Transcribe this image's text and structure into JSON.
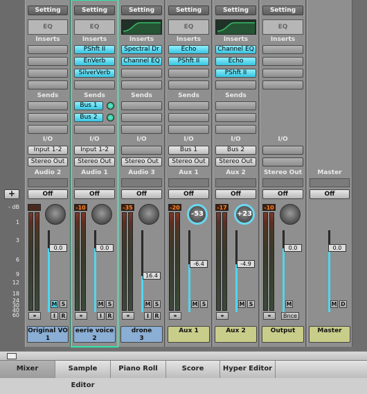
{
  "strips": [
    {
      "id": "audio2",
      "setting": "Setting",
      "eq_label": "EQ",
      "eq_curve": false,
      "inserts_label": "Inserts",
      "inserts": [
        "",
        "",
        "",
        ""
      ],
      "sends_label": "Sends",
      "sends": [
        "",
        "",
        ""
      ],
      "io_label": "I/O",
      "input": "Input 1-2",
      "output": "Stereo Out",
      "strip_label": "Audio 2",
      "auto": "Off",
      "peak": "",
      "knob_value": "",
      "fader_value": "0.0",
      "m": "M",
      "s": "S",
      "i": "I",
      "r": "R",
      "ms_on": true,
      "name": "Original VO\n1",
      "name_color": "blue",
      "selected": false
    },
    {
      "id": "audio1",
      "setting": "Setting",
      "eq_label": "EQ",
      "eq_curve": false,
      "inserts_label": "Inserts",
      "inserts": [
        "PShft II",
        "EnVerb",
        "SilverVerb",
        ""
      ],
      "sends_label": "Sends",
      "sends": [
        "Bus 1",
        "Bus 2",
        ""
      ],
      "io_label": "I/O",
      "input": "Input 1-2",
      "output": "Stereo Out",
      "strip_label": "Audio 1",
      "auto": "Off",
      "peak": "-10",
      "knob_value": "",
      "fader_value": "0.0",
      "m": "M",
      "s": "S",
      "i": "I",
      "r": "R",
      "ms_on": false,
      "name": "eerie voice\n2",
      "name_color": "blue",
      "selected": true
    },
    {
      "id": "audio3",
      "setting": "Setting",
      "eq_label": "",
      "eq_curve": true,
      "inserts_label": "Inserts",
      "inserts": [
        "Spectral Dr",
        "Channel EQ",
        "",
        ""
      ],
      "sends_label": "Sends",
      "sends": [
        "",
        "",
        ""
      ],
      "io_label": "I/O",
      "input": "",
      "output": "Stereo Out",
      "strip_label": "Audio 3",
      "auto": "Off",
      "peak": "-35",
      "knob_value": "",
      "fader_value": "16.4",
      "m": "M",
      "s": "S",
      "i": "I",
      "r": "R",
      "ms_on": false,
      "name": "drone\n3",
      "name_color": "blue",
      "selected": false
    },
    {
      "id": "aux1",
      "setting": "Setting",
      "eq_label": "EQ",
      "eq_curve": false,
      "inserts_label": "Inserts",
      "inserts": [
        "Echo",
        "PShft II",
        "",
        ""
      ],
      "sends_label": "Sends",
      "sends": [
        "",
        "",
        ""
      ],
      "io_label": "I/O",
      "input": "Bus 1",
      "output": "Stereo Out",
      "strip_label": "Aux 1",
      "auto": "Off",
      "peak": "-20",
      "knob_value": "-53",
      "fader_value": "-6.4",
      "m": "M",
      "s": "S",
      "i": "",
      "r": "",
      "ms_on": false,
      "name": "Aux 1",
      "name_color": "green",
      "selected": false
    },
    {
      "id": "aux2",
      "setting": "Setting",
      "eq_label": "",
      "eq_curve": true,
      "inserts_label": "Inserts",
      "inserts": [
        "Channel EQ",
        "Echo",
        "PShft II",
        ""
      ],
      "sends_label": "Sends",
      "sends": [
        "",
        "",
        ""
      ],
      "io_label": "I/O",
      "input": "Bus 2",
      "output": "Stereo Out",
      "strip_label": "Aux 2",
      "auto": "Off",
      "peak": "-17",
      "knob_value": "+23",
      "fader_value": "-4.9",
      "m": "M",
      "s": "S",
      "i": "",
      "r": "",
      "ms_on": false,
      "name": "Aux 2",
      "name_color": "green",
      "selected": false
    },
    {
      "id": "stereo_out",
      "setting": "Setting",
      "eq_label": "EQ",
      "eq_curve": false,
      "inserts_label": "Inserts",
      "inserts": [
        "",
        "",
        "",
        ""
      ],
      "sends_label": "",
      "sends": [],
      "io_label": "I/O",
      "input": "",
      "output": "",
      "strip_label": "Stereo Out",
      "auto": "Off",
      "peak": "-10",
      "knob_value": "",
      "fader_value": "0.0",
      "m": "M",
      "s": "",
      "i": "",
      "r": "",
      "ms_on": false,
      "bnce": "Bnce",
      "name": "Output",
      "name_color": "green",
      "selected": false
    },
    {
      "id": "master",
      "setting": "",
      "eq_label": "",
      "eq_curve": false,
      "inserts_label": "",
      "inserts": [],
      "sends_label": "",
      "sends": [],
      "io_label": "",
      "input": "",
      "output": "",
      "strip_label": "Master",
      "auto": "Off",
      "peak": "",
      "knob_value": "",
      "fader_value": "0.0",
      "m": "M",
      "s": "D",
      "i": "",
      "r": "",
      "ms_on": false,
      "name": "Master",
      "name_color": "green",
      "selected": false
    }
  ],
  "scale": {
    "db_label": "- dB",
    "marks": [
      "1",
      "3",
      "6",
      "9",
      "12",
      "18",
      "24",
      "30",
      "40",
      "60"
    ]
  },
  "plus_label": "+",
  "tabs": [
    "Mixer",
    "Sample Editor",
    "Piano Roll",
    "Score",
    "Hyper Editor"
  ],
  "active_tab": "Mixer",
  "colors": {
    "selection": "#2ee6a8",
    "active_slot": "#37c4e0",
    "name_blue": "#8aaed4",
    "name_green": "#c9cd8a"
  }
}
